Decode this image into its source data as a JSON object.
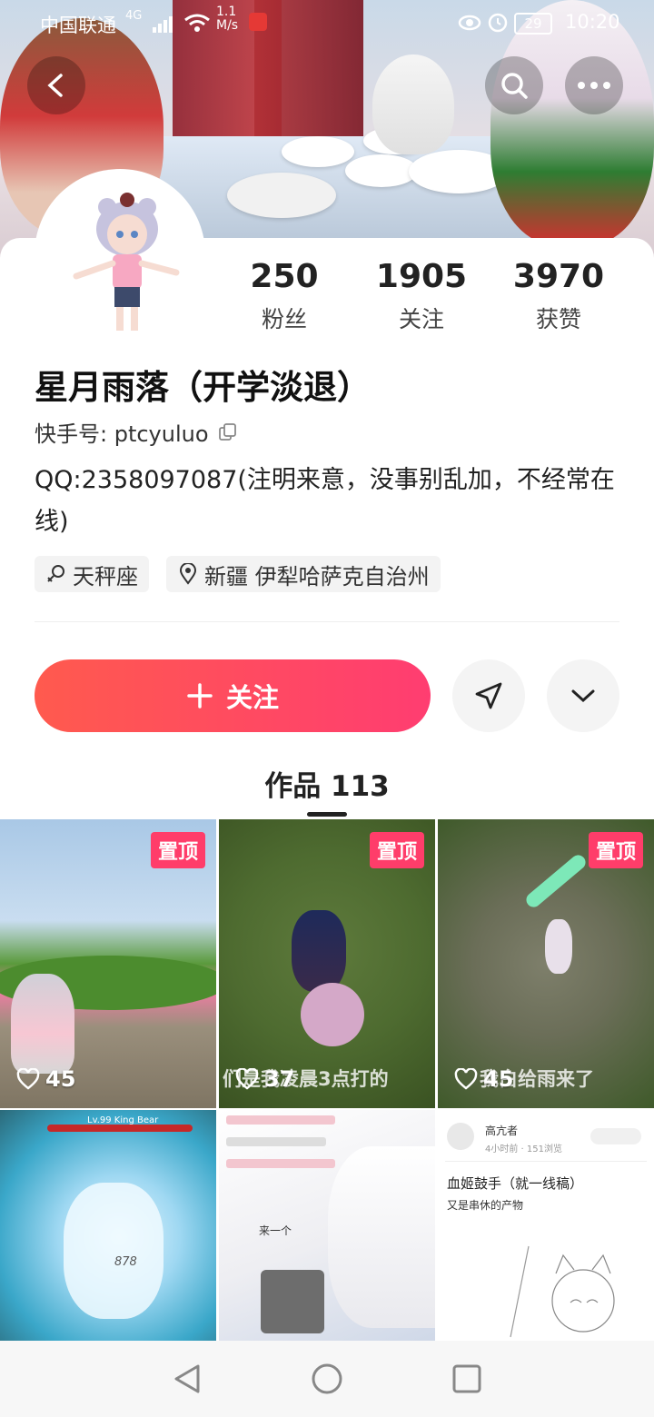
{
  "status_bar": {
    "carrier": "中国联通",
    "network": "4G",
    "speed": "1.1\nM/s",
    "battery": "29",
    "time": "10:20"
  },
  "profile": {
    "stats": [
      {
        "value": "250",
        "label": "粉丝"
      },
      {
        "value": "1905",
        "label": "关注"
      },
      {
        "value": "3970",
        "label": "获赞"
      }
    ],
    "name": "星月雨落（开学淡退）",
    "kuaishou_id": "快手号: ptcyuluo",
    "bio": "QQ:2358097087(注明来意，没事别乱加，不经常在线)",
    "tags": [
      "天秤座",
      "新疆 伊犁哈萨克自治州"
    ]
  },
  "actions": {
    "follow_label": "关注"
  },
  "works": {
    "tab_label": "作品 113",
    "items": [
      {
        "pinned_label": "置顶",
        "likes": "45",
        "caption": ""
      },
      {
        "pinned_label": "置顶",
        "likes": "37",
        "caption": "们是我凌晨3点打的"
      },
      {
        "pinned_label": "置顶",
        "likes": "45",
        "caption": "我白给雨来了"
      },
      {
        "title": "Lv.99 King Bear",
        "number": "878"
      },
      {
        "chat_text": "来一个"
      },
      {
        "author": "高亢者",
        "meta": "4小时前 · 151浏览",
        "post_title": "血姬鼓手（就一线稿）",
        "post_sub": "又是串休的产物"
      }
    ]
  },
  "colors": {
    "accent_start": "#ff5a4e",
    "accent_end": "#ff3d71",
    "pin": "#ff3d6a"
  }
}
